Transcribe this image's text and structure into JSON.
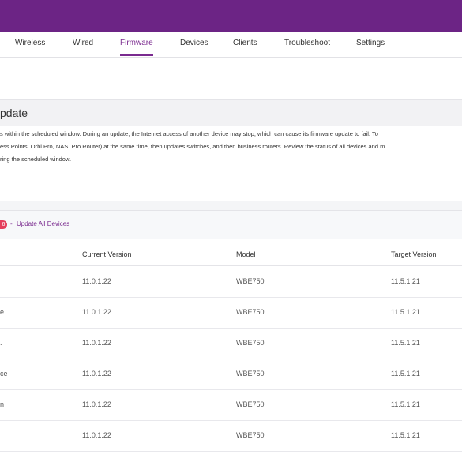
{
  "nav": {
    "tabs": [
      {
        "label": "Wireless",
        "active": false
      },
      {
        "label": "Wired",
        "active": false
      },
      {
        "label": "Firmware",
        "active": true
      },
      {
        "label": "Devices",
        "active": false
      },
      {
        "label": "Clients",
        "active": false
      },
      {
        "label": "Troubleshoot",
        "active": false
      },
      {
        "label": "Settings",
        "active": false
      }
    ]
  },
  "section": {
    "title": "pdate",
    "description": [
      "s within the scheduled window. During an update, the Internet access of another device may stop, which can cause its firmware update to fail. To",
      "ess Points, Orbi Pro, NAS, Pro Router) at the same time, then updates switches, and then business routers. Review the status of all devices and m",
      "ring the scheduled window."
    ]
  },
  "card": {
    "badge": "6",
    "separator": "-",
    "update_all_label": "Update All Devices"
  },
  "table": {
    "headers": [
      "Current Version",
      "Model",
      "Target Version"
    ],
    "rows": [
      {
        "name": "",
        "current": "11.0.1.22",
        "model": "WBE750",
        "target": "11.5.1.21"
      },
      {
        "name": "e",
        "current": "11.0.1.22",
        "model": "WBE750",
        "target": "11.5.1.21"
      },
      {
        "name": ".",
        "current": "11.0.1.22",
        "model": "WBE750",
        "target": "11.5.1.21"
      },
      {
        "name": "ce",
        "current": "11.0.1.22",
        "model": "WBE750",
        "target": "11.5.1.21"
      },
      {
        "name": "n",
        "current": "11.0.1.22",
        "model": "WBE750",
        "target": "11.5.1.21"
      },
      {
        "name": "",
        "current": "11.0.1.22",
        "model": "WBE750",
        "target": "11.5.1.21"
      }
    ]
  },
  "colors": {
    "brand": "#6c2485",
    "accent": "#7a2a8f",
    "badge": "#e53e5c"
  }
}
